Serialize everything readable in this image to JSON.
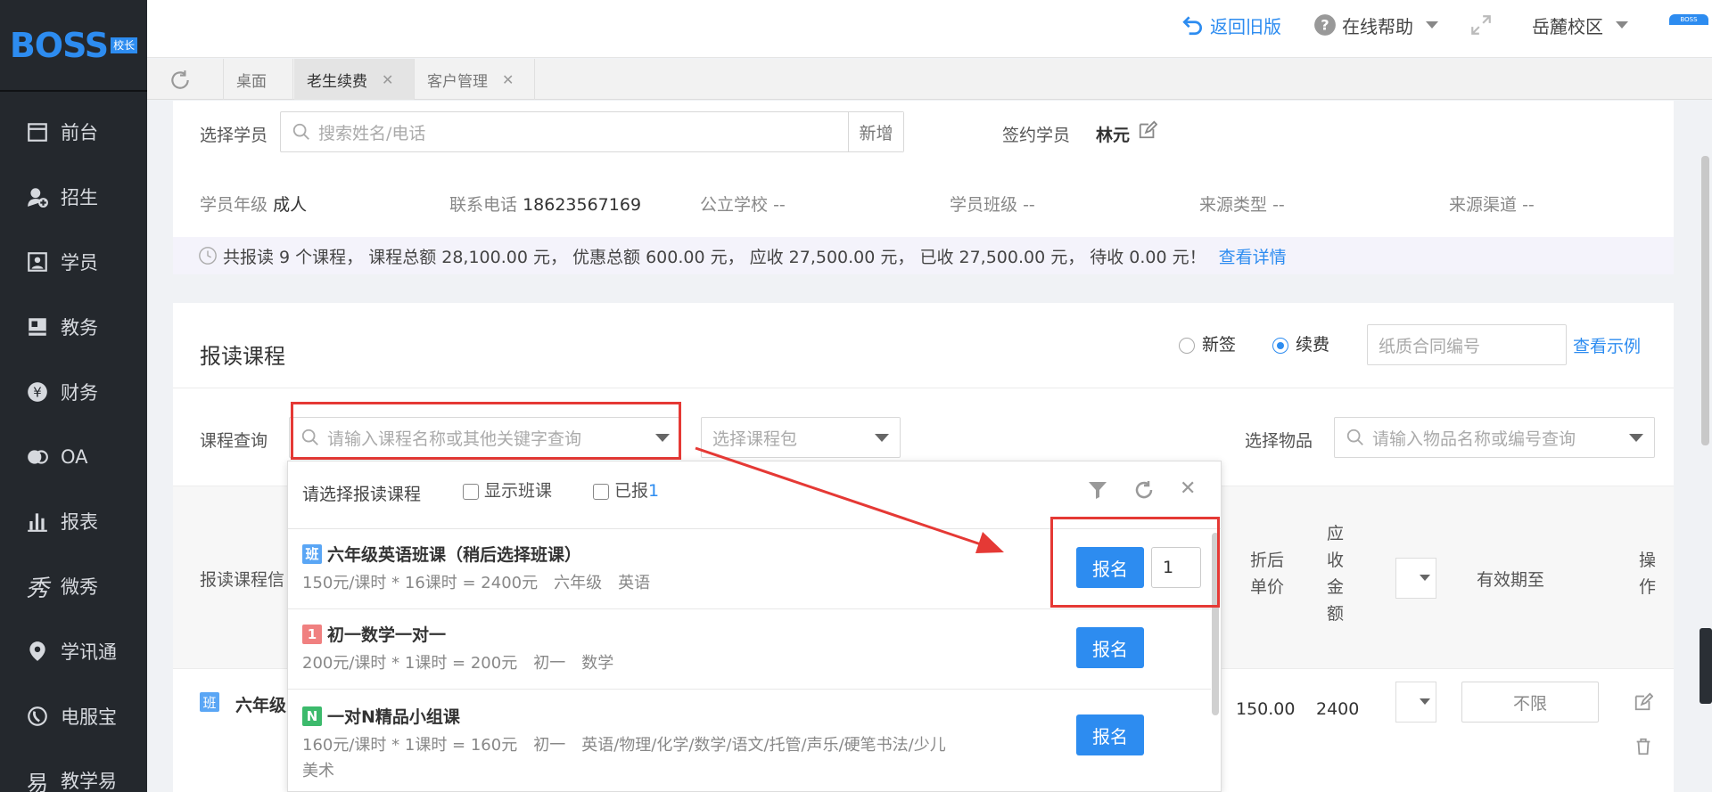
{
  "sidebar": {
    "logo": "BOSS",
    "logo_badge": "校长",
    "items": [
      {
        "label": "前台",
        "icon": "calendar-icon"
      },
      {
        "label": "招生",
        "icon": "add-user-icon"
      },
      {
        "label": "学员",
        "icon": "id-card-icon"
      },
      {
        "label": "教务",
        "icon": "book-icon"
      },
      {
        "label": "财务",
        "icon": "yen-icon"
      },
      {
        "label": "OA",
        "icon": "oa-icon"
      },
      {
        "label": "报表",
        "icon": "bar-chart-icon"
      },
      {
        "label": "微秀",
        "icon": "show-icon"
      },
      {
        "label": "学讯通",
        "icon": "location-icon"
      },
      {
        "label": "电服宝",
        "icon": "phone-service-icon"
      },
      {
        "label": "教学易",
        "icon": "teach-icon"
      }
    ]
  },
  "topbar": {
    "back_old": "返回旧版",
    "help": "在线帮助",
    "campus": "岳麓校区",
    "avatar_text": "BOSS"
  },
  "tabs": [
    {
      "label": "桌面",
      "closable": false,
      "active": false
    },
    {
      "label": "老生续费",
      "closable": true,
      "active": true
    },
    {
      "label": "客户管理",
      "closable": true,
      "active": false
    }
  ],
  "student": {
    "select_label": "选择学员",
    "search_placeholder": "搜索姓名/电话",
    "add_label": "新增",
    "signed_label": "签约学员",
    "signed_name": "林元",
    "grade_label": "学员年级",
    "grade": "成人",
    "phone_label": "联系电话",
    "phone": "18623567169",
    "school_label": "公立学校",
    "school": "--",
    "class_label": "学员班级",
    "class": "--",
    "source_type_label": "来源类型",
    "source_type": "--",
    "source_channel_label": "来源渠道",
    "source_channel": "--"
  },
  "summary": {
    "text": "共报读 9 个课程， 课程总额 28,100.00 元， 优惠总额 600.00 元， 应收 27,500.00 元， 已收 27,500.00 元， 待收 0.00 元！",
    "link": "查看详情"
  },
  "enroll": {
    "title": "报读课程",
    "radio_new": "新签",
    "radio_renew": "续费",
    "contract_placeholder": "纸质合同编号",
    "example_link": "查看示例",
    "course_query_label": "课程查询",
    "course_query_placeholder": "请输入课程名称或其他关键字查询",
    "package_placeholder": "选择课程包",
    "goods_label": "选择物品",
    "goods_placeholder": "请输入物品名称或编号查询"
  },
  "table": {
    "col_course": "报读课程信",
    "col_price": "折后单价",
    "col_amount": "应收金额",
    "col_valid": "有效期至",
    "col_op": "操作",
    "row_tag": "班",
    "row_name": "六年级",
    "row_price": "150.00",
    "row_amount": "2400",
    "row_valid": "不限"
  },
  "popup": {
    "title": "请选择报读课程",
    "show_class": "显示班课",
    "enrolled": "已报",
    "enrolled_count": "1",
    "courses": [
      {
        "tag": "班",
        "tag_color": "#5aa6f5",
        "name": "六年级英语班课（稍后选择班课）",
        "desc": "150元/课时 * 16课时 = 2400元　六年级　英语",
        "button": "报名",
        "qty": "1"
      },
      {
        "tag": "1",
        "tag_color": "#f08080",
        "name": "初一数学一对一",
        "desc": "200元/课时 * 1课时 = 200元　初一　数学",
        "button": "报名"
      },
      {
        "tag": "N",
        "tag_color": "#3cba6c",
        "name": "一对N精品小组课",
        "desc": "160元/课时 * 1课时 = 160元　初一　英语/物理/化学/数学/语文/托管/声乐/硬笔书法/少儿",
        "desc2": "美术",
        "button": "报名"
      }
    ]
  },
  "colors": {
    "primary": "#2d8cf0",
    "sidebar_bg": "#24282d",
    "highlight_red": "#e53935"
  }
}
